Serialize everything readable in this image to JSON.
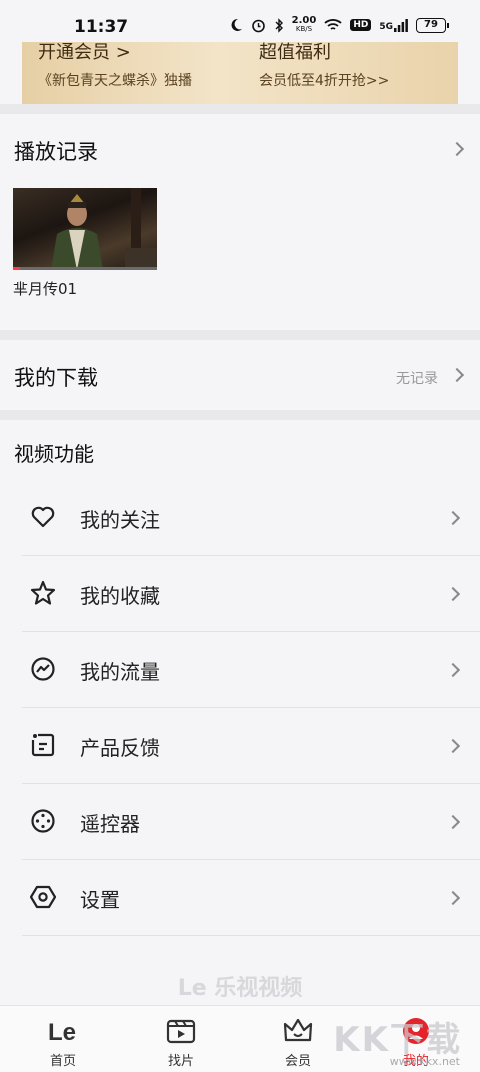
{
  "status_bar": {
    "time": "11:37",
    "speed_value": "2.00",
    "speed_unit": "KB/S",
    "hd_badge": "HD",
    "network": "5G",
    "battery": "79"
  },
  "vip_banner": {
    "left_title": "开通会员  >",
    "left_subtitle": "《新包青天之蝶杀》独播",
    "right_title": "超值福利",
    "right_subtitle": "会员低至4折开抢>>"
  },
  "history": {
    "title": "播放记录",
    "items": [
      {
        "caption": "芈月传01",
        "progress": 0.05
      }
    ]
  },
  "downloads": {
    "title": "我的下载",
    "status": "无记录"
  },
  "video_functions": {
    "title": "视频功能",
    "items": [
      {
        "label": "我的关注",
        "icon": "heart-icon"
      },
      {
        "label": "我的收藏",
        "icon": "star-icon"
      },
      {
        "label": "我的流量",
        "icon": "traffic-icon"
      },
      {
        "label": "产品反馈",
        "icon": "feedback-icon"
      },
      {
        "label": "遥控器",
        "icon": "remote-icon"
      },
      {
        "label": "设置",
        "icon": "settings-icon"
      }
    ]
  },
  "brand": "Le 乐视视频",
  "tabs": [
    {
      "label": "首页",
      "icon": "le-logo-icon",
      "active": false
    },
    {
      "label": "找片",
      "icon": "play-box-icon",
      "active": false
    },
    {
      "label": "会员",
      "icon": "crown-icon",
      "active": false
    },
    {
      "label": "我的",
      "icon": "profile-icon",
      "active": true
    }
  ],
  "watermark": {
    "text": "KK下载",
    "url": "www.kkx.net"
  },
  "colors": {
    "accent": "#e3242b",
    "vip_gold": "#e6cfa5",
    "background": "#f5f5f7"
  }
}
